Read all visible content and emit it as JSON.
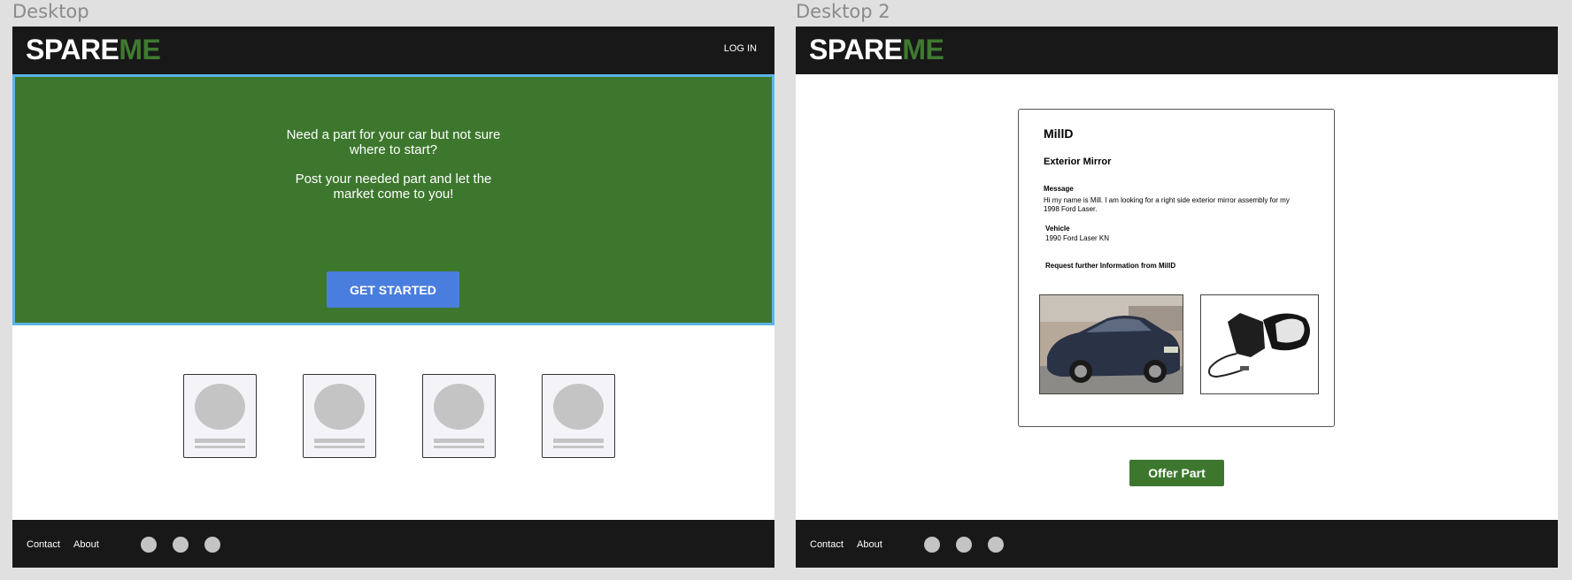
{
  "frames": [
    {
      "label": "Desktop"
    },
    {
      "label": "Desktop 2"
    }
  ],
  "logo": {
    "part1": "SPARE",
    "part2": "ME"
  },
  "nav": {
    "login": "LOG IN"
  },
  "hero": {
    "line1a": "Need a part for your car but not sure",
    "line1b": "where to start?",
    "line2a": "Post your needed part and let the",
    "line2b": "market come to you!",
    "cta": "GET STARTED"
  },
  "footer": {
    "contact": "Contact",
    "about": "About"
  },
  "request": {
    "user": "MillD",
    "part": "Exterior Mirror",
    "message_label": "Message",
    "message_line1": "Hi my name is Mill. I am looking for a right side exterior mirror assembly for my",
    "message_line2": "1998 Ford Laser.",
    "vehicle_label": "Vehicle",
    "vehicle": "1990 Ford Laser KN",
    "request_info": "Request further Information from MillD",
    "offer_button": "Offer Part"
  },
  "colors": {
    "brand_green": "#3d772e",
    "cta_blue": "#4a7ede",
    "selection_blue": "#5bb5e6",
    "nav_dark": "#181818"
  },
  "icons": {
    "social": [
      "social-icon",
      "social-icon",
      "social-icon"
    ]
  }
}
